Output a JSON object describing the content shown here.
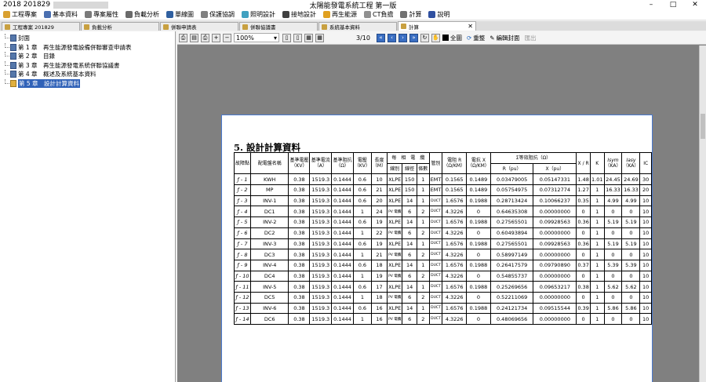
{
  "window": {
    "app_title": "2018 201829",
    "doc_title": "太陽能發電系統工程 第一版",
    "minimize": "–",
    "maximize": "□",
    "close": "✕"
  },
  "menu": [
    {
      "label": "工程專案",
      "color": "#d9a030"
    },
    {
      "label": "基本資料",
      "color": "#4a6fb0"
    },
    {
      "label": "專案屬性",
      "color": "#7a7a7a"
    },
    {
      "label": "負載分析",
      "color": "#6a6a6a"
    },
    {
      "label": "單線圖",
      "color": "#3060a0"
    },
    {
      "label": "保護協調",
      "color": "#808080"
    },
    {
      "label": "照明設計",
      "color": "#40a0c0"
    },
    {
      "label": "接地設計",
      "color": "#404040"
    },
    {
      "label": "再生能源",
      "color": "#e0a020"
    },
    {
      "label": "CT負擔",
      "color": "#909090"
    },
    {
      "label": "計算",
      "color": "#707070"
    },
    {
      "label": "說明",
      "color": "#3050a0"
    }
  ],
  "tabs": [
    {
      "label": "工程專案 201829",
      "active": false
    },
    {
      "label": "負載分析",
      "active": false
    },
    {
      "label": "併聯申請表",
      "active": false
    },
    {
      "label": "併聯協議書",
      "active": false
    },
    {
      "label": "系統基本資料",
      "active": false
    },
    {
      "label": "計算",
      "active": true
    }
  ],
  "tree": [
    {
      "label": "封面",
      "selected": false
    },
    {
      "label": "第 1 章　再生能源發電設備併聯審查申請表",
      "selected": false
    },
    {
      "label": "第 2 章　目錄",
      "selected": false
    },
    {
      "label": "第 3 章　再生能源發電系統併聯協議書",
      "selected": false
    },
    {
      "label": "第 4 章　概述及系統基本資料",
      "selected": false
    },
    {
      "label": "第 5 章　設計計算資料",
      "selected": true
    }
  ],
  "toolbar": {
    "zoom": "100%",
    "page": "3/10",
    "full_screen": "全圖",
    "redraw": "重整",
    "edit_cover": "編輯封面",
    "export": "匯出"
  },
  "document": {
    "title": "5. 設計計算資料",
    "headers": {
      "fault": "故障點",
      "panel": "配電盤名稱",
      "base_v": "基準電壓",
      "base_v_unit": "（KV）",
      "base_i": "基準電流",
      "base_i_unit": "（A）",
      "base_z": "基準阻抗",
      "base_z_unit": "（Ω）",
      "volt": "電壓",
      "volt_unit": "（KV）",
      "len": "長度",
      "len_unit": "（M）",
      "cable": "每　相　電　纜",
      "cable_type": "線別",
      "cable_size": "線徑",
      "cable_count": "條數",
      "conduit": "管別",
      "r": "電阻 R",
      "r_unit": "（Ω/KM）",
      "x": "電抗 X",
      "x_unit": "（Ω/KM）",
      "sum_z": "Σ等效阻抗（Ω）",
      "sum_r": "R（pu）",
      "sum_x": "X（pu）",
      "xr": "X / R",
      "k": "K",
      "isym": "Isym",
      "isym_unit": "（KA）",
      "iasy": "Iasy",
      "iasy_unit": "（KA）",
      "ic": "IC"
    },
    "rows": [
      [
        "ƒ - 1",
        "KWH",
        "0.38",
        "1519.3",
        "0.1444",
        "0.6",
        "10",
        "XLPE",
        "150",
        "1",
        "EMT",
        "0.1565",
        "0.1489",
        "0.03479005",
        "0.05147331",
        "1.48",
        "1.01",
        "24.45",
        "24.69",
        "30"
      ],
      [
        "ƒ - 2",
        "MP",
        "0.38",
        "1519.3",
        "0.1444",
        "0.6",
        "21",
        "XLPE",
        "150",
        "1",
        "EMT",
        "0.1565",
        "0.1489",
        "0.05754975",
        "0.07312774",
        "1.27",
        "1",
        "16.33",
        "16.33",
        "20"
      ],
      [
        "ƒ - 3",
        "INV-1",
        "0.38",
        "1519.3",
        "0.1444",
        "0.6",
        "20",
        "XLPE",
        "14",
        "1",
        "DUCT",
        "1.6576",
        "0.1988",
        "0.28713424",
        "0.10066237",
        "0.35",
        "1",
        "4.99",
        "4.99",
        "10"
      ],
      [
        "ƒ - 4",
        "DC1",
        "0.38",
        "1519.3",
        "0.1444",
        "1",
        "24",
        "PV 電纜",
        "6",
        "2",
        "DUCT",
        "4.3226",
        "0",
        "0.64635308",
        "0.00000000",
        "0",
        "1",
        "0",
        "0",
        "10"
      ],
      [
        "ƒ - 5",
        "INV-2",
        "0.38",
        "1519.3",
        "0.1444",
        "0.6",
        "19",
        "XLPE",
        "14",
        "1",
        "DUCT",
        "1.6576",
        "0.1988",
        "0.27565501",
        "0.09928563",
        "0.36",
        "1",
        "5.19",
        "5.19",
        "10"
      ],
      [
        "ƒ - 6",
        "DC2",
        "0.38",
        "1519.3",
        "0.1444",
        "1",
        "22",
        "PV 電纜",
        "6",
        "2",
        "DUCT",
        "4.3226",
        "0",
        "0.60493894",
        "0.00000000",
        "0",
        "1",
        "0",
        "0",
        "10"
      ],
      [
        "ƒ - 7",
        "INV-3",
        "0.38",
        "1519.3",
        "0.1444",
        "0.6",
        "19",
        "XLPE",
        "14",
        "1",
        "DUCT",
        "1.6576",
        "0.1988",
        "0.27565501",
        "0.09928563",
        "0.36",
        "1",
        "5.19",
        "5.19",
        "10"
      ],
      [
        "ƒ - 8",
        "DC3",
        "0.38",
        "1519.3",
        "0.1444",
        "1",
        "21",
        "PV 電纜",
        "6",
        "2",
        "DUCT",
        "4.3226",
        "0",
        "0.58997149",
        "0.00000000",
        "0",
        "1",
        "0",
        "0",
        "10"
      ],
      [
        "ƒ - 9",
        "INV-4",
        "0.38",
        "1519.3",
        "0.1444",
        "0.6",
        "18",
        "XLPE",
        "14",
        "1",
        "DUCT",
        "1.6576",
        "0.1988",
        "0.26417579",
        "0.09790890",
        "0.37",
        "1",
        "5.39",
        "5.39",
        "10"
      ],
      [
        "ƒ - 10",
        "DC4",
        "0.38",
        "1519.3",
        "0.1444",
        "1",
        "19",
        "PV 電纜",
        "6",
        "2",
        "DUCT",
        "4.3226",
        "0",
        "0.54855737",
        "0.00000000",
        "0",
        "1",
        "0",
        "0",
        "10"
      ],
      [
        "ƒ - 11",
        "INV-5",
        "0.38",
        "1519.3",
        "0.1444",
        "0.6",
        "17",
        "XLPE",
        "14",
        "1",
        "DUCT",
        "1.6576",
        "0.1988",
        "0.25269656",
        "0.09653217",
        "0.38",
        "1",
        "5.62",
        "5.62",
        "10"
      ],
      [
        "ƒ - 12",
        "DC5",
        "0.38",
        "1519.3",
        "0.1444",
        "1",
        "18",
        "PV 電纜",
        "6",
        "2",
        "DUCT",
        "4.3226",
        "0",
        "0.52211069",
        "0.00000000",
        "0",
        "1",
        "0",
        "0",
        "10"
      ],
      [
        "ƒ - 13",
        "INV-6",
        "0.38",
        "1519.3",
        "0.1444",
        "0.6",
        "16",
        "XLPE",
        "14",
        "1",
        "DUCT",
        "1.6576",
        "0.1988",
        "0.24121734",
        "0.09515544",
        "0.39",
        "1",
        "5.86",
        "5.86",
        "10"
      ],
      [
        "ƒ - 14",
        "DC6",
        "0.38",
        "1519.3",
        "0.1444",
        "1",
        "16",
        "PV 電纜",
        "6",
        "2",
        "DUCT",
        "4.3226",
        "0",
        "0.48069656",
        "0.00000000",
        "0",
        "1",
        "0",
        "0",
        "10"
      ]
    ]
  }
}
